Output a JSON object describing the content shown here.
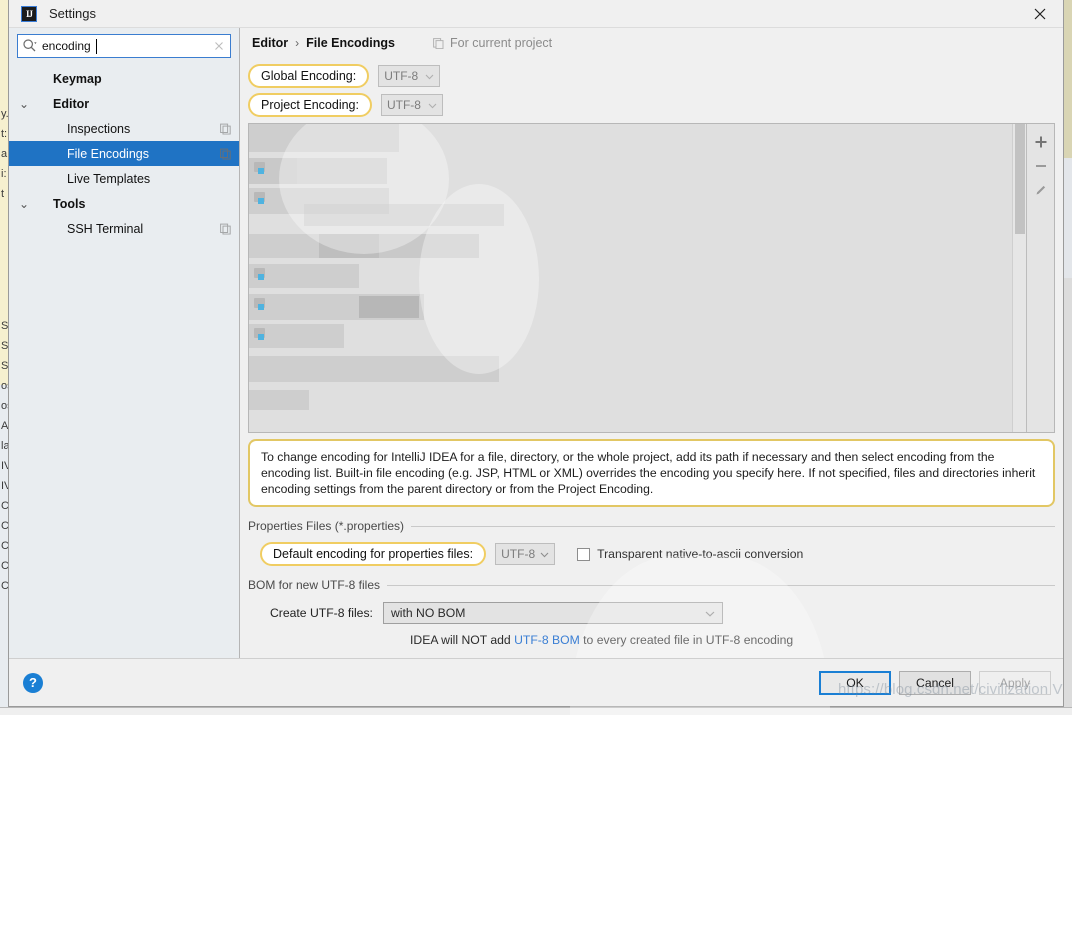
{
  "window": {
    "title": "Settings",
    "app_icon": "intellij-idea-icon",
    "close_icon": "close-icon"
  },
  "search": {
    "value": "encoding",
    "placeholder": "",
    "icon": "search-icon",
    "clear_icon": "clear-icon"
  },
  "sidebar": {
    "items": [
      {
        "label": "Keymap",
        "level": 0,
        "bold": true,
        "arrow": "",
        "selected": false,
        "badge": false
      },
      {
        "label": "Editor",
        "level": 0,
        "bold": true,
        "arrow": "⌄",
        "selected": false,
        "badge": false
      },
      {
        "label": "Inspections",
        "level": 2,
        "bold": false,
        "arrow": "",
        "selected": false,
        "badge": true
      },
      {
        "label": "File Encodings",
        "level": 2,
        "bold": false,
        "arrow": "",
        "selected": true,
        "badge": true
      },
      {
        "label": "Live Templates",
        "level": 2,
        "bold": false,
        "arrow": "",
        "selected": false,
        "badge": false
      },
      {
        "label": "Tools",
        "level": 0,
        "bold": true,
        "arrow": "⌄",
        "selected": false,
        "badge": false
      },
      {
        "label": "SSH Terminal",
        "level": 2,
        "bold": false,
        "arrow": "",
        "selected": false,
        "badge": true
      }
    ]
  },
  "breadcrumb": {
    "parent": "Editor",
    "separator": "›",
    "current": "File Encodings",
    "scope_label": "For current project",
    "scope_icon": "copy-settings-icon"
  },
  "encodings": {
    "global": {
      "label": "Global Encoding:",
      "value": "UTF-8"
    },
    "project": {
      "label": "Project Encoding:",
      "value": "UTF-8"
    }
  },
  "table_tools": {
    "add_icon": "plus-icon",
    "remove_icon": "minus-icon",
    "edit_icon": "pencil-icon"
  },
  "info_note": {
    "text": "To change encoding for IntelliJ IDEA for a file, directory, or the whole project, add its path if necessary and then select encoding from the encoding list. Built-in file encoding (e.g. JSP, HTML or XML) overrides the encoding you specify here. If not specified, files and directories inherit encoding settings from the parent directory or from the Project Encoding."
  },
  "properties_group": {
    "title": "Properties Files (*.properties)",
    "default_encoding_label": "Default encoding for properties files:",
    "default_encoding_value": "UTF-8",
    "native_ascii_label": "Transparent native-to-ascii conversion",
    "native_ascii_checked": false
  },
  "bom_group": {
    "title": "BOM for new UTF-8 files",
    "create_label": "Create UTF-8 files:",
    "create_value": "with NO BOM",
    "hint_prefix": "IDEA will NOT add ",
    "hint_link": "UTF-8 BOM",
    "hint_suffix": " to every created file in UTF-8 encoding"
  },
  "footer": {
    "help_label": "?",
    "ok_label": "OK",
    "cancel_label": "Cancel",
    "apply_label": "Apply"
  },
  "watermark": {
    "text": "https://blog.csdn.net/civilization V"
  },
  "colors": {
    "accent_blue": "#1f73c4",
    "highlight_yellow": "#f0cd62",
    "link_blue": "#3b7fd4",
    "selection_bg": "#1f73c4"
  },
  "background_fragments": [
    "y.",
    "t:",
    "a",
    "i:",
    "t",
    "Se",
    "Se",
    "Se",
    "os",
    "os",
    "Ar",
    "la",
    "IV",
    "IV",
    "CA",
    "CA",
    "Co",
    "Co",
    "Co"
  ]
}
